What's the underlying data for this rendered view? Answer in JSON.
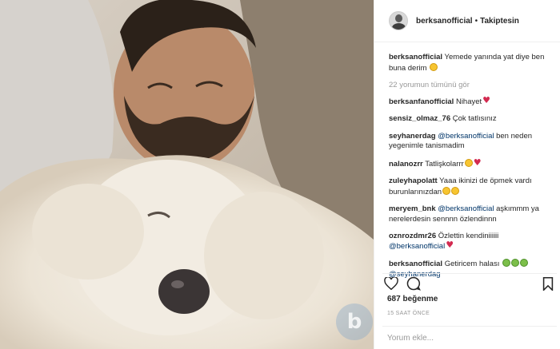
{
  "photo": {
    "alt": "",
    "watermark_letter": "b"
  },
  "header": {
    "username": "berksanofficial",
    "separator": "•",
    "follow_status": "Takiptesin"
  },
  "caption": {
    "username": "berksanofficial",
    "text": "Yemede yanında yat diye ben buna derim"
  },
  "view_all_comments": "22 yorumun tümünü gör",
  "comments": [
    {
      "username": "berksanfanofficial",
      "text": "Nihayet"
    },
    {
      "username": "sensiz_olmaz_76",
      "text": "Çok tatlısınız"
    },
    {
      "username": "seyhanerdag",
      "mention": "@berksanofficial",
      "text": "ben neden yegenimle tanismadim"
    },
    {
      "username": "nalanozrr",
      "text": "Tatlişkolarrr"
    },
    {
      "username": "zuleyhapolatt",
      "text": "Yaaa ikinizi de öpmek vardı burunlarınızdan"
    },
    {
      "username": "meryem_bnk",
      "mention": "@berksanofficial",
      "text": "aşkımmm ya nerelerdesin sennnn özlendinnn"
    },
    {
      "username": "oznrozdmr26",
      "text": "Özlettin kendiniiiiii",
      "mention2": "@berksanofficial"
    },
    {
      "username": "berksanofficial",
      "text": "Getiricem halası",
      "mention2": "@seyhanerdag"
    }
  ],
  "actions": {
    "like_icon": "heart-icon",
    "comment_icon": "comment-icon",
    "bookmark_icon": "bookmark-icon"
  },
  "likes_text": "687 beğenme",
  "timestamp": "15 SAAT ÖNCE",
  "add_comment_placeholder": "Yorum ekle..."
}
